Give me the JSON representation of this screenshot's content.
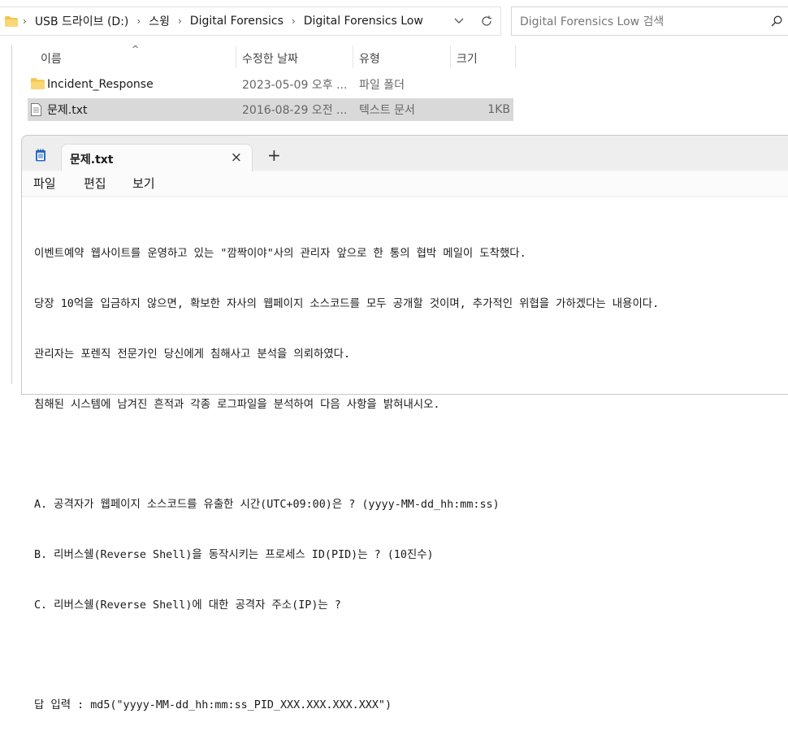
{
  "explorer": {
    "breadcrumb": [
      "USB 드라이브 (D:)",
      "스윙",
      "Digital Forensics",
      "Digital Forensics Low"
    ],
    "search_placeholder": "Digital Forensics Low 검색",
    "columns": {
      "name": "이름",
      "modified": "수정한 날짜",
      "type": "유형",
      "size": "크기"
    },
    "files": [
      {
        "name": "Incident_Response",
        "modified": "2023-05-09 오후 ...",
        "type": "파일 폴더",
        "size": "",
        "icon": "folder-icon",
        "selected": false
      },
      {
        "name": "문제.txt",
        "modified": "2016-08-29 오전 ...",
        "type": "텍스트 문서",
        "size": "1KB",
        "icon": "text-file-icon",
        "selected": true
      }
    ]
  },
  "notepad": {
    "tab_title": "문제.txt",
    "menu": [
      "파일",
      "편집",
      "보기"
    ],
    "content_lines": [
      "이벤트예약 웹사이트를 운영하고 있는 \"깜짝이야\"사의 관리자 앞으로 한 통의 협박 메일이 도착했다.",
      "당장 10억을 입금하지 않으면, 확보한 자사의 웹페이지 소스코드를 모두 공개할 것이며, 추가적인 위협을 가하겠다는 내용이다.",
      "관리자는 포렌직 전문가인 당신에게 침해사고 분석을 의뢰하였다.",
      "침해된 시스템에 남겨진 흔적과 각종 로그파일을 분석하여 다음 사항을 밝혀내시오.",
      "",
      "A. 공격자가 웹페이지 소스코드를 유출한 시간(UTC+09:00)은 ? (yyyy-MM-dd_hh:mm:ss)",
      "B. 리버스쉘(Reverse Shell)을 동작시키는 프로세스 ID(PID)는 ? (10진수)",
      "C. 리버스쉘(Reverse Shell)에 대한 공격자 주소(IP)는 ?",
      "",
      "답 입력 : md5(\"yyyy-MM-dd_hh:mm:ss_PID_XXX.XXX.XXX.XXX\")"
    ]
  },
  "colors": {
    "selected_row": "#d9d9d9",
    "folder": "#f4c44e",
    "notepad_icon": "#2b6cc4"
  }
}
